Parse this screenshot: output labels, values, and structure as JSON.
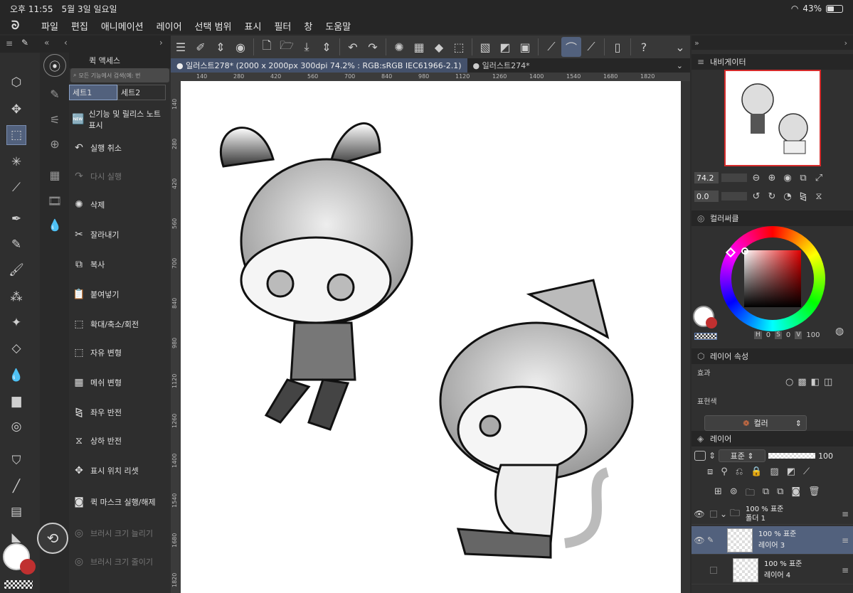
{
  "status": {
    "time": "오후 11:55",
    "date": "5월 3일 일요일",
    "battery": "43%"
  },
  "menu": [
    "파일",
    "편집",
    "애니메이션",
    "레이어",
    "선택 범위",
    "표시",
    "필터",
    "창",
    "도움말"
  ],
  "quick_access": {
    "title": "퀵 액세스",
    "search_placeholder": "모든 기능에서 검색(예: 번",
    "tabs": [
      "세트1",
      "세트2"
    ],
    "items": [
      {
        "label": "신기능 및 릴리스 노트 표시",
        "icon": "new-icon",
        "enabled": true
      },
      {
        "label": "실행 취소",
        "icon": "undo-icon",
        "enabled": true
      },
      {
        "label": "다시 실행",
        "icon": "redo-icon",
        "enabled": false
      },
      {
        "label": "삭제",
        "icon": "delete-icon",
        "enabled": true
      },
      {
        "label": "잘라내기",
        "icon": "scissors-icon",
        "enabled": true
      },
      {
        "label": "복사",
        "icon": "copy-icon",
        "enabled": true
      },
      {
        "label": "붙여넣기",
        "icon": "paste-icon",
        "enabled": true
      },
      {
        "label": "확대/축소/회전",
        "icon": "transform-icon",
        "enabled": true
      },
      {
        "label": "자유 변형",
        "icon": "free-transform-icon",
        "enabled": true
      },
      {
        "label": "메쉬 변형",
        "icon": "mesh-icon",
        "enabled": true
      },
      {
        "label": "좌우 반전",
        "icon": "flip-horizontal-icon",
        "enabled": true
      },
      {
        "label": "상하 반전",
        "icon": "flip-vertical-icon",
        "enabled": true
      },
      {
        "label": "표시 위치 리셋",
        "icon": "reset-position-icon",
        "enabled": true
      },
      {
        "label": "퀵 마스크 실행/해제",
        "icon": "quick-mask-icon",
        "enabled": true
      },
      {
        "label": "브러시 크기 늘리기",
        "icon": "brush-up-icon",
        "enabled": false
      },
      {
        "label": "브러시 크기 줄이기",
        "icon": "brush-down-icon",
        "enabled": false
      }
    ]
  },
  "documents": [
    {
      "label": "일러스트278* (2000 x 2000px 300dpi 74.2% : RGB:sRGB IEC61966-2.1)",
      "active": true
    },
    {
      "label": "일러스트274*",
      "active": false
    }
  ],
  "ruler_top": [
    "140",
    "280",
    "420",
    "560",
    "700",
    "840",
    "980",
    "1120",
    "1260",
    "1400",
    "1540",
    "1680",
    "1820"
  ],
  "ruler_left": [
    "140",
    "280",
    "420",
    "560",
    "700",
    "840",
    "980",
    "1120",
    "1260",
    "1400",
    "1540",
    "1680",
    "1820"
  ],
  "navigator": {
    "title": "내비게이터",
    "zoom": "74.2",
    "rotation": "0.0"
  },
  "color_wheel": {
    "title": "컬러써클",
    "h": "0",
    "s": "0",
    "v": "100",
    "h_label": "H",
    "s_label": "S",
    "v_label": "V"
  },
  "layer_property": {
    "title": "레이어 속성",
    "effect_label": "효과",
    "expression_label": "표현색",
    "expression_value": "컬러"
  },
  "layers": {
    "title": "레이어",
    "blend": "표준",
    "opacity": "100",
    "items": [
      {
        "line1": "100 % 표준",
        "line2": "폴더 1",
        "type": "folder",
        "selected": false
      },
      {
        "line1": "100 % 표준",
        "line2": "레이어 3",
        "type": "layer",
        "selected": true
      },
      {
        "line1": "100 % 표준",
        "line2": "레이어 4",
        "type": "layer",
        "selected": false
      }
    ]
  },
  "colors": {
    "accent": "#52617d",
    "main_color": "#ffffff",
    "sub_color": "#c03030"
  }
}
